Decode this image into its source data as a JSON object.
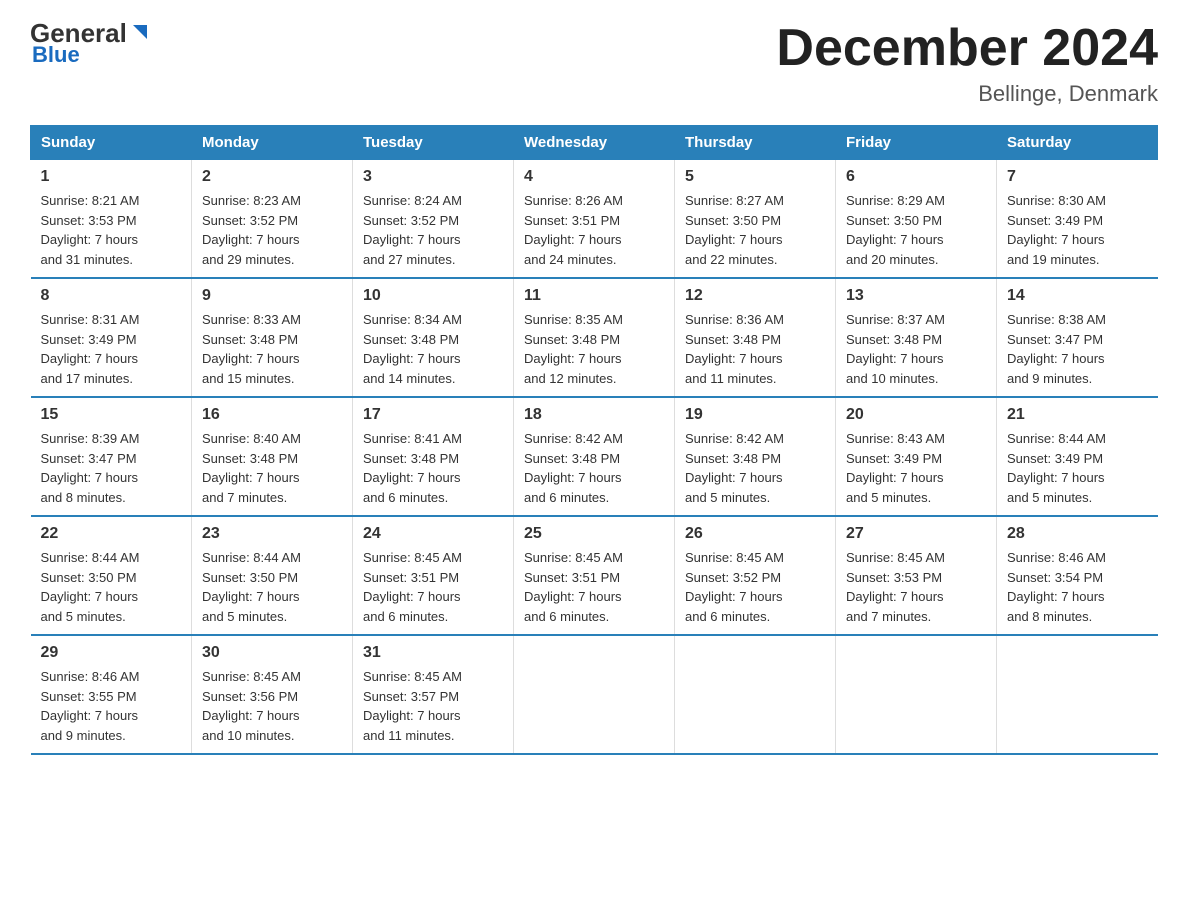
{
  "logo": {
    "general": "General",
    "blue": "Blue"
  },
  "header": {
    "title": "December 2024",
    "subtitle": "Bellinge, Denmark"
  },
  "weekdays": [
    "Sunday",
    "Monday",
    "Tuesday",
    "Wednesday",
    "Thursday",
    "Friday",
    "Saturday"
  ],
  "weeks": [
    [
      {
        "day": "1",
        "sunrise": "8:21 AM",
        "sunset": "3:53 PM",
        "daylight": "7 hours and 31 minutes."
      },
      {
        "day": "2",
        "sunrise": "8:23 AM",
        "sunset": "3:52 PM",
        "daylight": "7 hours and 29 minutes."
      },
      {
        "day": "3",
        "sunrise": "8:24 AM",
        "sunset": "3:52 PM",
        "daylight": "7 hours and 27 minutes."
      },
      {
        "day": "4",
        "sunrise": "8:26 AM",
        "sunset": "3:51 PM",
        "daylight": "7 hours and 24 minutes."
      },
      {
        "day": "5",
        "sunrise": "8:27 AM",
        "sunset": "3:50 PM",
        "daylight": "7 hours and 22 minutes."
      },
      {
        "day": "6",
        "sunrise": "8:29 AM",
        "sunset": "3:50 PM",
        "daylight": "7 hours and 20 minutes."
      },
      {
        "day": "7",
        "sunrise": "8:30 AM",
        "sunset": "3:49 PM",
        "daylight": "7 hours and 19 minutes."
      }
    ],
    [
      {
        "day": "8",
        "sunrise": "8:31 AM",
        "sunset": "3:49 PM",
        "daylight": "7 hours and 17 minutes."
      },
      {
        "day": "9",
        "sunrise": "8:33 AM",
        "sunset": "3:48 PM",
        "daylight": "7 hours and 15 minutes."
      },
      {
        "day": "10",
        "sunrise": "8:34 AM",
        "sunset": "3:48 PM",
        "daylight": "7 hours and 14 minutes."
      },
      {
        "day": "11",
        "sunrise": "8:35 AM",
        "sunset": "3:48 PM",
        "daylight": "7 hours and 12 minutes."
      },
      {
        "day": "12",
        "sunrise": "8:36 AM",
        "sunset": "3:48 PM",
        "daylight": "7 hours and 11 minutes."
      },
      {
        "day": "13",
        "sunrise": "8:37 AM",
        "sunset": "3:48 PM",
        "daylight": "7 hours and 10 minutes."
      },
      {
        "day": "14",
        "sunrise": "8:38 AM",
        "sunset": "3:47 PM",
        "daylight": "7 hours and 9 minutes."
      }
    ],
    [
      {
        "day": "15",
        "sunrise": "8:39 AM",
        "sunset": "3:47 PM",
        "daylight": "7 hours and 8 minutes."
      },
      {
        "day": "16",
        "sunrise": "8:40 AM",
        "sunset": "3:48 PM",
        "daylight": "7 hours and 7 minutes."
      },
      {
        "day": "17",
        "sunrise": "8:41 AM",
        "sunset": "3:48 PM",
        "daylight": "7 hours and 6 minutes."
      },
      {
        "day": "18",
        "sunrise": "8:42 AM",
        "sunset": "3:48 PM",
        "daylight": "7 hours and 6 minutes."
      },
      {
        "day": "19",
        "sunrise": "8:42 AM",
        "sunset": "3:48 PM",
        "daylight": "7 hours and 5 minutes."
      },
      {
        "day": "20",
        "sunrise": "8:43 AM",
        "sunset": "3:49 PM",
        "daylight": "7 hours and 5 minutes."
      },
      {
        "day": "21",
        "sunrise": "8:44 AM",
        "sunset": "3:49 PM",
        "daylight": "7 hours and 5 minutes."
      }
    ],
    [
      {
        "day": "22",
        "sunrise": "8:44 AM",
        "sunset": "3:50 PM",
        "daylight": "7 hours and 5 minutes."
      },
      {
        "day": "23",
        "sunrise": "8:44 AM",
        "sunset": "3:50 PM",
        "daylight": "7 hours and 5 minutes."
      },
      {
        "day": "24",
        "sunrise": "8:45 AM",
        "sunset": "3:51 PM",
        "daylight": "7 hours and 6 minutes."
      },
      {
        "day": "25",
        "sunrise": "8:45 AM",
        "sunset": "3:51 PM",
        "daylight": "7 hours and 6 minutes."
      },
      {
        "day": "26",
        "sunrise": "8:45 AM",
        "sunset": "3:52 PM",
        "daylight": "7 hours and 6 minutes."
      },
      {
        "day": "27",
        "sunrise": "8:45 AM",
        "sunset": "3:53 PM",
        "daylight": "7 hours and 7 minutes."
      },
      {
        "day": "28",
        "sunrise": "8:46 AM",
        "sunset": "3:54 PM",
        "daylight": "7 hours and 8 minutes."
      }
    ],
    [
      {
        "day": "29",
        "sunrise": "8:46 AM",
        "sunset": "3:55 PM",
        "daylight": "7 hours and 9 minutes."
      },
      {
        "day": "30",
        "sunrise": "8:45 AM",
        "sunset": "3:56 PM",
        "daylight": "7 hours and 10 minutes."
      },
      {
        "day": "31",
        "sunrise": "8:45 AM",
        "sunset": "3:57 PM",
        "daylight": "7 hours and 11 minutes."
      },
      null,
      null,
      null,
      null
    ]
  ],
  "labels": {
    "sunrise": "Sunrise:",
    "sunset": "Sunset:",
    "daylight": "Daylight:"
  }
}
